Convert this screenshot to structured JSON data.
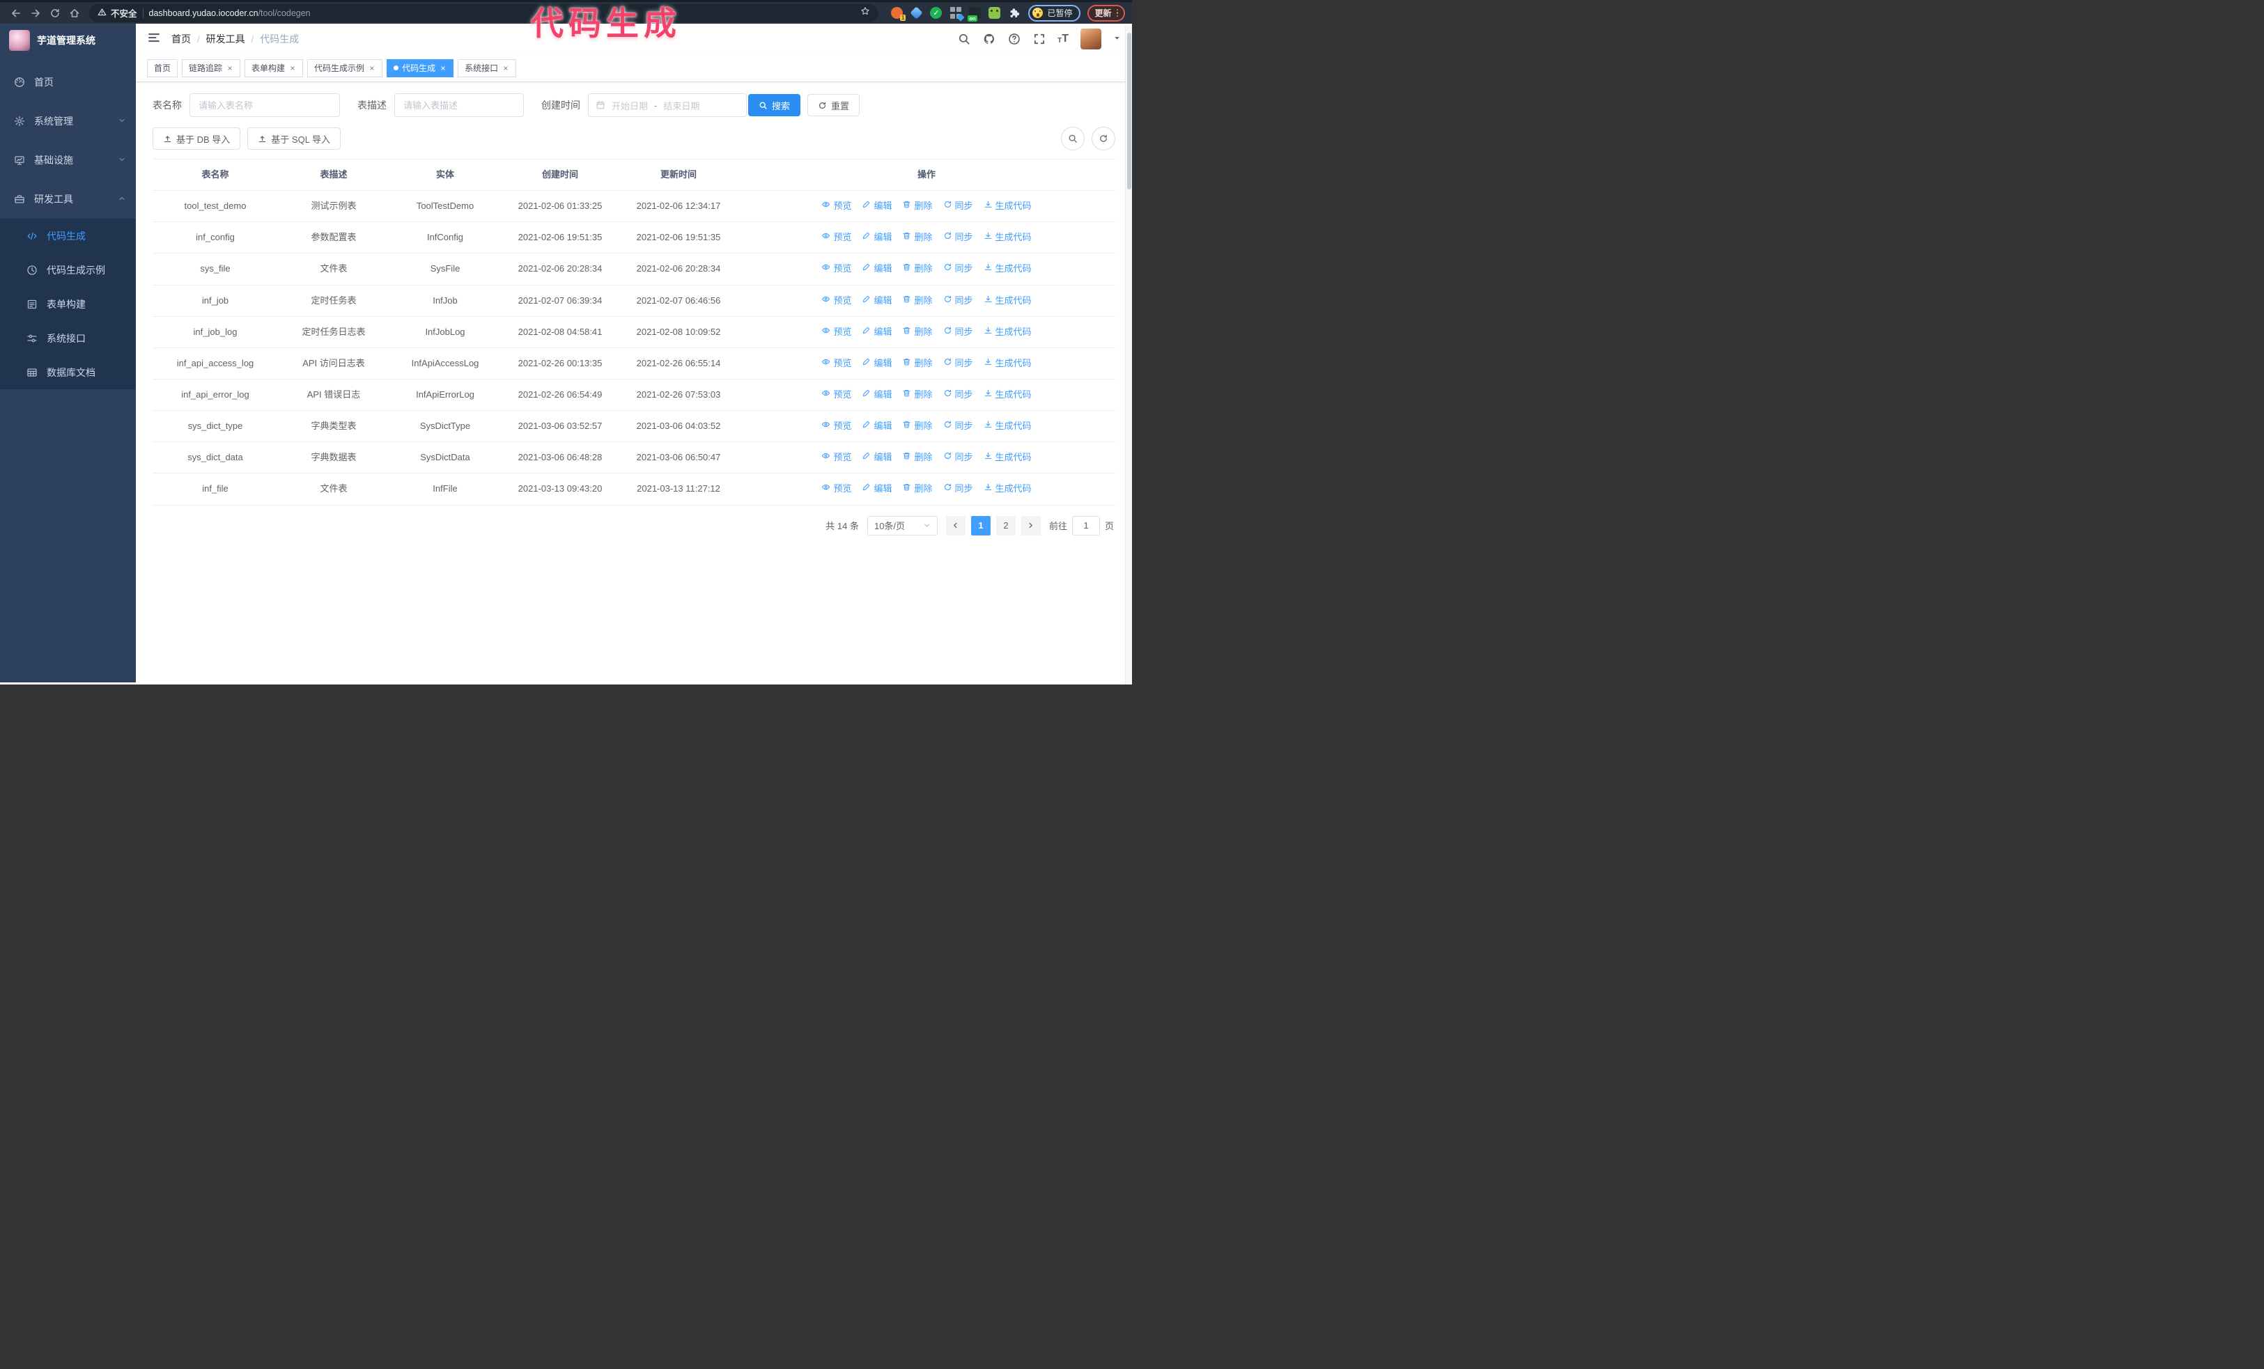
{
  "colors": {
    "accent": "#409eff",
    "annotation_pink": "#f4436b",
    "sidebar_bg": "#2d405e",
    "submenu_bg": "#20334f"
  },
  "annotation": {
    "text": "代码生成"
  },
  "browser": {
    "security_label": "不安全",
    "url_host": "dashboard.yudao.iocoder.cn",
    "url_path": "/tool/codegen",
    "paused_badge": "已暂停",
    "update_label": "更新",
    "extension_badge_count": "1",
    "extension_badge_on": "on"
  },
  "sidebar": {
    "title": "芋道管理系统",
    "menu": [
      {
        "label": "首页",
        "icon": "dashboard-icon",
        "chevron": null,
        "active": false
      },
      {
        "label": "系统管理",
        "icon": "gear-icon",
        "chevron": "down",
        "active": false
      },
      {
        "label": "基础设施",
        "icon": "monitor-icon",
        "chevron": "down",
        "active": false
      },
      {
        "label": "研发工具",
        "icon": "toolbox-icon",
        "chevron": "up",
        "active": true
      }
    ],
    "submenu": [
      {
        "label": "代码生成",
        "icon": "code-icon",
        "active": true
      },
      {
        "label": "代码生成示例",
        "icon": "example-icon",
        "active": false
      },
      {
        "label": "表单构建",
        "icon": "form-icon",
        "active": false
      },
      {
        "label": "系统接口",
        "icon": "api-icon",
        "active": false
      },
      {
        "label": "数据库文档",
        "icon": "db-doc-icon",
        "active": false
      }
    ]
  },
  "navbar": {
    "breadcrumb": [
      "首页",
      "研发工具",
      "代码生成"
    ]
  },
  "tabs": [
    {
      "label": "首页",
      "closable": false,
      "active": false
    },
    {
      "label": "链路追踪",
      "closable": true,
      "active": false
    },
    {
      "label": "表单构建",
      "closable": true,
      "active": false
    },
    {
      "label": "代码生成示例",
      "closable": true,
      "active": false
    },
    {
      "label": "代码生成",
      "closable": true,
      "active": true
    },
    {
      "label": "系统接口",
      "closable": true,
      "active": false
    }
  ],
  "filters": {
    "table_name_label": "表名称",
    "table_name_placeholder": "请输入表名称",
    "table_desc_label": "表描述",
    "table_desc_placeholder": "请输入表描述",
    "create_time_label": "创建时间",
    "start_placeholder": "开始日期",
    "range_separator": "-",
    "end_placeholder": "结束日期",
    "search_label": "搜索",
    "reset_label": "重置"
  },
  "toolbar": {
    "db_import_label": "基于 DB 导入",
    "sql_import_label": "基于 SQL 导入"
  },
  "table": {
    "columns": [
      "表名称",
      "表描述",
      "实体",
      "创建时间",
      "更新时间",
      "操作"
    ],
    "actions": [
      {
        "label": "预览",
        "icon": "eye-icon"
      },
      {
        "label": "编辑",
        "icon": "edit-icon"
      },
      {
        "label": "删除",
        "icon": "delete-icon"
      },
      {
        "label": "同步",
        "icon": "sync-icon"
      },
      {
        "label": "生成代码",
        "icon": "download-icon"
      }
    ],
    "rows": [
      {
        "name": "tool_test_demo",
        "desc": "测试示例表",
        "entity": "ToolTestDemo",
        "created": "2021-02-06 01:33:25",
        "updated": "2021-02-06 12:34:17"
      },
      {
        "name": "inf_config",
        "desc": "参数配置表",
        "entity": "InfConfig",
        "created": "2021-02-06 19:51:35",
        "updated": "2021-02-06 19:51:35"
      },
      {
        "name": "sys_file",
        "desc": "文件表",
        "entity": "SysFile",
        "created": "2021-02-06 20:28:34",
        "updated": "2021-02-06 20:28:34"
      },
      {
        "name": "inf_job",
        "desc": "定时任务表",
        "entity": "InfJob",
        "created": "2021-02-07 06:39:34",
        "updated": "2021-02-07 06:46:56"
      },
      {
        "name": "inf_job_log",
        "desc": "定时任务日志表",
        "entity": "InfJobLog",
        "created": "2021-02-08 04:58:41",
        "updated": "2021-02-08 10:09:52"
      },
      {
        "name": "inf_api_access_log",
        "desc": "API 访问日志表",
        "entity": "InfApiAccessLog",
        "created": "2021-02-26 00:13:35",
        "updated": "2021-02-26 06:55:14"
      },
      {
        "name": "inf_api_error_log",
        "desc": "API 错误日志",
        "entity": "InfApiErrorLog",
        "created": "2021-02-26 06:54:49",
        "updated": "2021-02-26 07:53:03"
      },
      {
        "name": "sys_dict_type",
        "desc": "字典类型表",
        "entity": "SysDictType",
        "created": "2021-03-06 03:52:57",
        "updated": "2021-03-06 04:03:52"
      },
      {
        "name": "sys_dict_data",
        "desc": "字典数据表",
        "entity": "SysDictData",
        "created": "2021-03-06 06:48:28",
        "updated": "2021-03-06 06:50:47"
      },
      {
        "name": "inf_file",
        "desc": "文件表",
        "entity": "InfFile",
        "created": "2021-03-13 09:43:20",
        "updated": "2021-03-13 11:27:12"
      }
    ]
  },
  "pagination": {
    "total_text": "共 14 条",
    "page_size": "10条/页",
    "pages": [
      "1",
      "2"
    ],
    "active_page": "1",
    "goto_label": "前往",
    "goto_value": "1",
    "goto_suffix": "页"
  }
}
